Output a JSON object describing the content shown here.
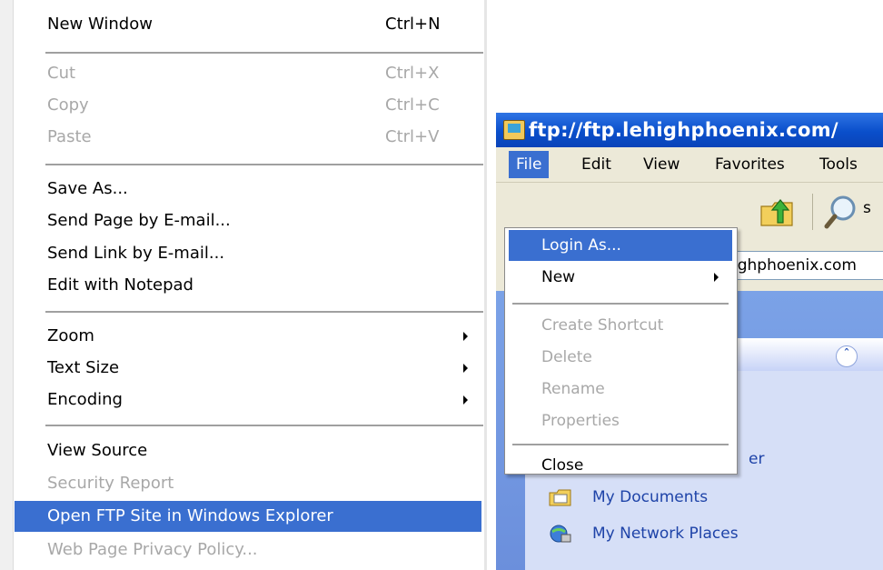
{
  "left_menu": {
    "items": [
      {
        "label": "New Window",
        "shortcut": "Ctrl+N"
      },
      {
        "label": "Cut",
        "shortcut": "Ctrl+X"
      },
      {
        "label": "Copy",
        "shortcut": "Ctrl+C"
      },
      {
        "label": "Paste",
        "shortcut": "Ctrl+V"
      },
      {
        "label": "Save As..."
      },
      {
        "label": "Send Page by E-mail..."
      },
      {
        "label": "Send Link by E-mail..."
      },
      {
        "label": "Edit with Notepad"
      },
      {
        "label": "Zoom"
      },
      {
        "label": "Text Size"
      },
      {
        "label": "Encoding"
      },
      {
        "label": "View Source"
      },
      {
        "label": "Security Report"
      },
      {
        "label": "Open FTP Site in Windows Explorer"
      },
      {
        "label": "Web Page Privacy Policy..."
      }
    ]
  },
  "explorer": {
    "title": "ftp://ftp.lehighphoenix.com/",
    "menu": [
      "File",
      "Edit",
      "View",
      "Favorites",
      "Tools"
    ],
    "toolbar": {
      "search_tail": "s"
    },
    "address": "ighphoenix.com",
    "tasks": [
      {
        "label": "",
        "tail": "er"
      },
      {
        "label": "My Documents"
      },
      {
        "label": "My Network Places"
      }
    ]
  },
  "file_menu": {
    "items": [
      {
        "label": "Login As..."
      },
      {
        "label": "New"
      },
      {
        "label": "Create Shortcut"
      },
      {
        "label": "Delete"
      },
      {
        "label": "Rename"
      },
      {
        "label": "Properties"
      },
      {
        "label": "Close"
      }
    ]
  },
  "colors": {
    "selection": "#3a6fd0",
    "titlebar": "#0a4fcb",
    "disabled": "#a8a8a8"
  }
}
